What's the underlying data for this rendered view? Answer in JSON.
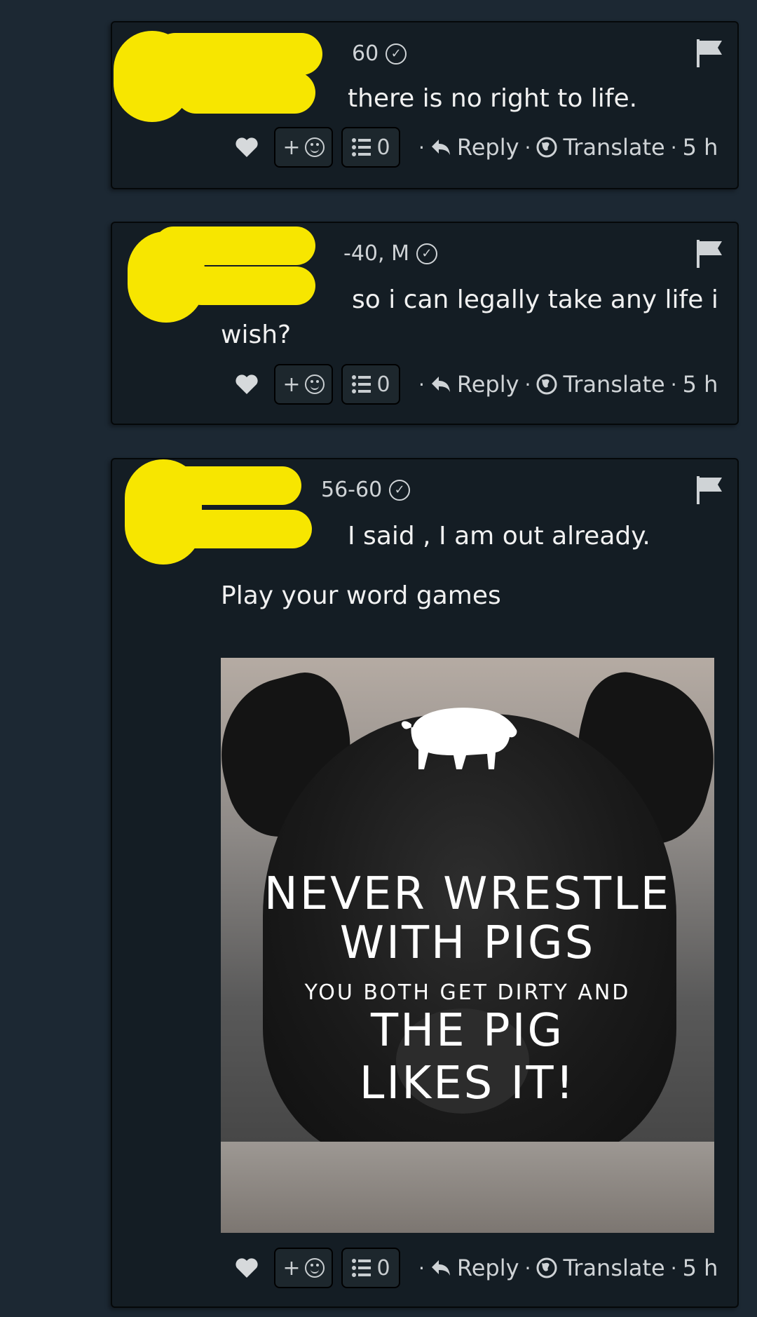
{
  "comments": [
    {
      "meta_suffix": "60",
      "text": "there is no right to life.",
      "actions": {
        "react_label": "+",
        "list_count": "0",
        "reply": "Reply",
        "translate": "Translate",
        "time": "5 h"
      }
    },
    {
      "meta_suffix": "-40, M",
      "text_line1": "so i can legally take any life i",
      "text_line2": "wish?",
      "actions": {
        "react_label": "+",
        "list_count": "0",
        "reply": "Reply",
        "translate": "Translate",
        "time": "5 h"
      }
    },
    {
      "meta_suffix": "56-60",
      "text_line1": "I said , I am out already.",
      "text_line2": "Play your word games",
      "image": {
        "line1": "NEVER WRESTLE",
        "line2": "WITH PIGS",
        "line3": "YOU BOTH GET DIRTY AND",
        "line4": "THE PIG",
        "line5": "LIKES IT!"
      },
      "actions": {
        "react_label": "+",
        "list_count": "0",
        "reply": "Reply",
        "translate": "Translate",
        "time": "5 h"
      }
    }
  ],
  "icons": [
    "heart-icon",
    "emoji-icon",
    "list-icon",
    "reply-arrow-icon",
    "globe-icon",
    "flag-icon",
    "verified-check-icon"
  ],
  "colors": {
    "background": "#1c2833",
    "card": "#141d24",
    "redaction": "#f7e600",
    "text": "#f1f1f1",
    "muted": "#cfd3d6"
  }
}
